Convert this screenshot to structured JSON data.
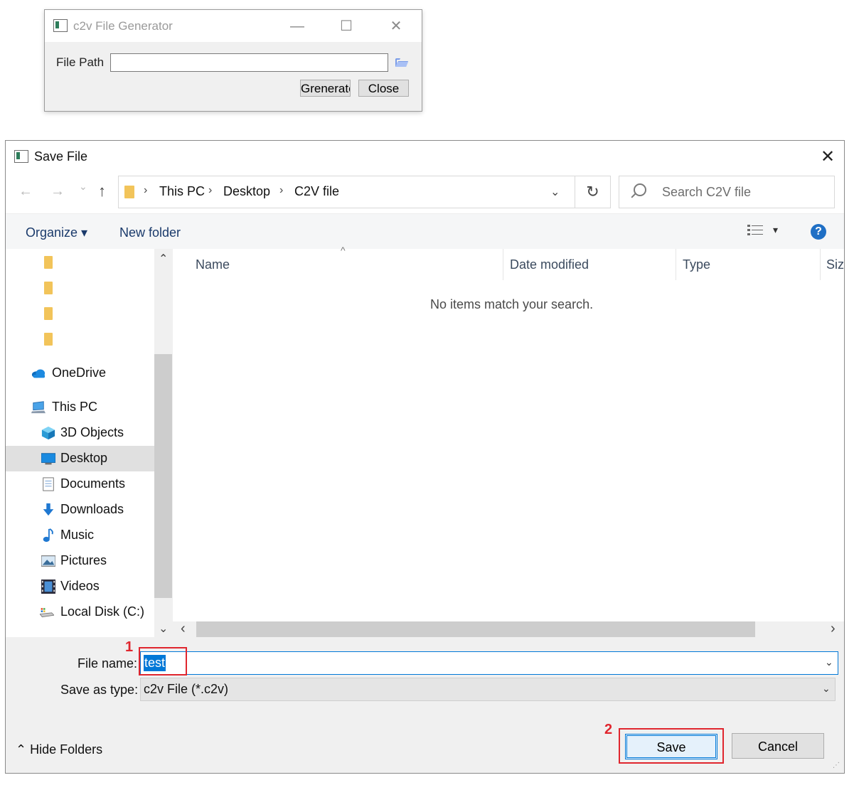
{
  "generator_window": {
    "title": "c2v File Generator",
    "icon": "app-icon",
    "minimize_glyph": "—",
    "maximize_glyph": "☐",
    "close_glyph": "✕",
    "file_path_label": "File Path",
    "file_path_value": "",
    "browse_icon": "folder-open-icon",
    "generate_label": "Grenerate",
    "close_label": "Close"
  },
  "save_dialog": {
    "title": "Save File",
    "close_glyph": "✕",
    "nav": {
      "back_glyph": "←",
      "forward_glyph": "→",
      "recent_glyph": "⌄",
      "up_glyph": "↑",
      "breadcrumbs": [
        "This PC",
        "Desktop",
        "C2V file"
      ],
      "separator": "›",
      "dropdown_glyph": "⌄",
      "refresh_glyph": "↻",
      "search_placeholder": "Search C2V file"
    },
    "toolbar": {
      "organize_label": "Organize ▾",
      "new_folder_label": "New folder",
      "view_dropdown_glyph": "▾",
      "help_glyph": "?"
    },
    "nav_pane": {
      "items": [
        {
          "label": "OneDrive",
          "icon": "onedrive-icon"
        },
        {
          "label": "This PC",
          "icon": "computer-icon"
        },
        {
          "label": "3D Objects",
          "icon": "cube-icon"
        },
        {
          "label": "Desktop",
          "icon": "desktop-icon",
          "selected": true
        },
        {
          "label": "Documents",
          "icon": "documents-icon"
        },
        {
          "label": "Downloads",
          "icon": "download-icon"
        },
        {
          "label": "Music",
          "icon": "music-icon"
        },
        {
          "label": "Pictures",
          "icon": "pictures-icon"
        },
        {
          "label": "Videos",
          "icon": "videos-icon"
        },
        {
          "label": "Local Disk (C:)",
          "icon": "disk-icon"
        }
      ],
      "scroll_up_glyph": "⌃",
      "scroll_down_glyph": "⌄"
    },
    "file_list": {
      "columns": [
        "Name",
        "Date modified",
        "Type",
        "Size"
      ],
      "sort_glyph": "^",
      "empty_message": "No items match your search.",
      "scroll_left_glyph": "‹",
      "scroll_right_glyph": "›"
    },
    "file_name_label": "File name:",
    "file_name_value": "test",
    "save_as_type_label": "Save as type:",
    "save_as_type_value": "c2v File (*.c2v)",
    "combo_glyph": "⌄",
    "hide_folders_label": "⌃  Hide Folders",
    "save_label": "Save",
    "cancel_label": "Cancel",
    "annotations": {
      "step1": "1",
      "step2": "2",
      "color": "#e0262e"
    }
  }
}
